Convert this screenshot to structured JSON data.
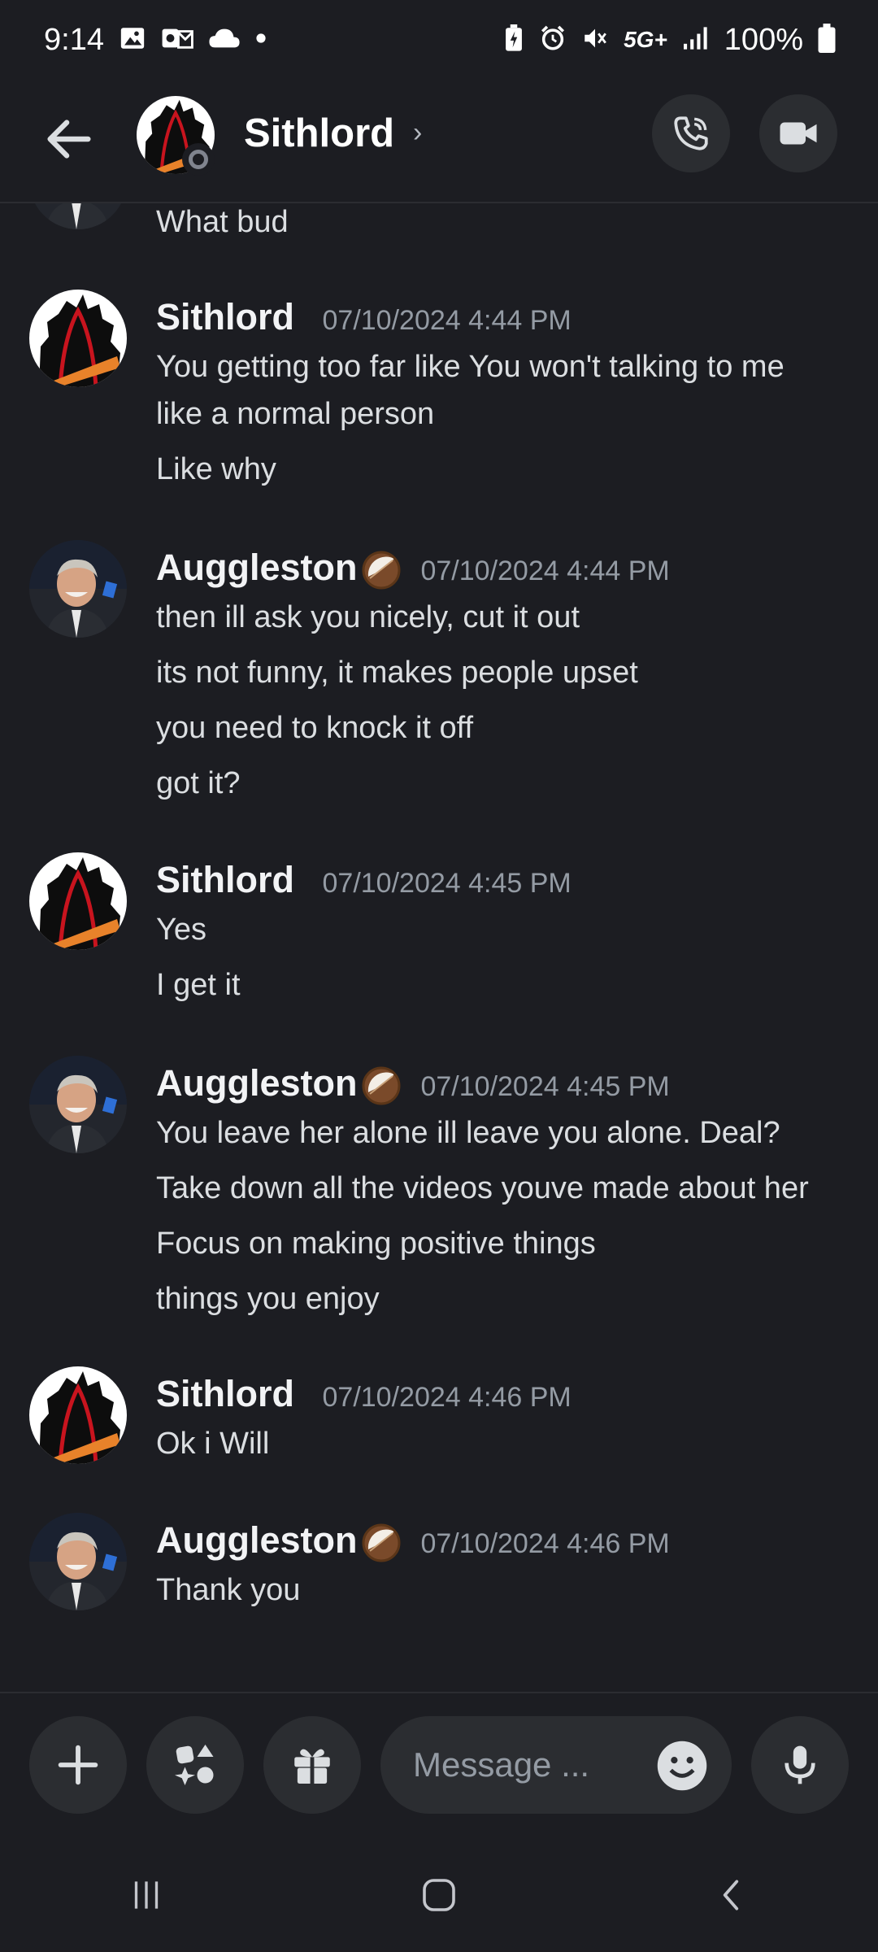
{
  "status_bar": {
    "time": "9:14",
    "network": "5G+",
    "battery": "100%",
    "left_icons": [
      "gallery-icon",
      "outlook-icon",
      "cloud-icon",
      "dot-icon"
    ],
    "right_icons": [
      "battery-saver-icon",
      "alarm-icon",
      "mute-icon",
      "network-5g-icon",
      "signal-icon",
      "battery-icon"
    ]
  },
  "header": {
    "title": "Sithlord",
    "chevron": "›",
    "back_icon": "arrow-left-icon",
    "call_icon": "phone-icon",
    "video_icon": "video-icon"
  },
  "messages": [
    {
      "author": "",
      "timestamp": "",
      "lines": [
        "What bud"
      ],
      "continuation": true,
      "avatar": "cody"
    },
    {
      "author": "Sithlord",
      "timestamp": "07/10/2024 4:44 PM",
      "avatar": "sith",
      "lines": [
        "You getting too far like You won't talking to me",
        "like a normal person",
        "Like why"
      ]
    },
    {
      "author": "Auggleston",
      "timestamp": "07/10/2024 4:44 PM",
      "avatar": "cody",
      "emoji": "coconut",
      "lines": [
        "then ill ask you nicely, cut it out",
        "its not funny, it makes people upset",
        "you need to knock it off",
        "got it?"
      ]
    },
    {
      "author": "Sithlord",
      "timestamp": "07/10/2024 4:45 PM",
      "avatar": "sith",
      "lines": [
        "Yes",
        "I get it"
      ]
    },
    {
      "author": "Auggleston",
      "timestamp": "07/10/2024 4:45 PM",
      "avatar": "cody",
      "emoji": "coconut",
      "lines": [
        "You leave her alone ill leave you alone. Deal?",
        "Take down all the videos youve made about her",
        "Focus on making positive things",
        "things you enjoy"
      ]
    },
    {
      "author": "Sithlord",
      "timestamp": "07/10/2024 4:46 PM",
      "avatar": "sith",
      "lines": [
        "Ok i Will"
      ]
    },
    {
      "author": "Auggleston",
      "timestamp": "07/10/2024 4:46 PM",
      "avatar": "cody",
      "emoji": "coconut",
      "lines": [
        "Thank you"
      ]
    }
  ],
  "composer": {
    "placeholder": "Message ...",
    "buttons": [
      "plus-icon",
      "apps-icon",
      "gift-icon",
      "emoji-icon",
      "microphone-icon"
    ]
  },
  "nav_bar": {
    "buttons": [
      "recents-icon",
      "home-icon",
      "back-icon"
    ]
  },
  "colors": {
    "background": "#1c1d22",
    "button_bg": "#2b2d31",
    "text": "#dbdee1",
    "muted": "#949ba4"
  }
}
